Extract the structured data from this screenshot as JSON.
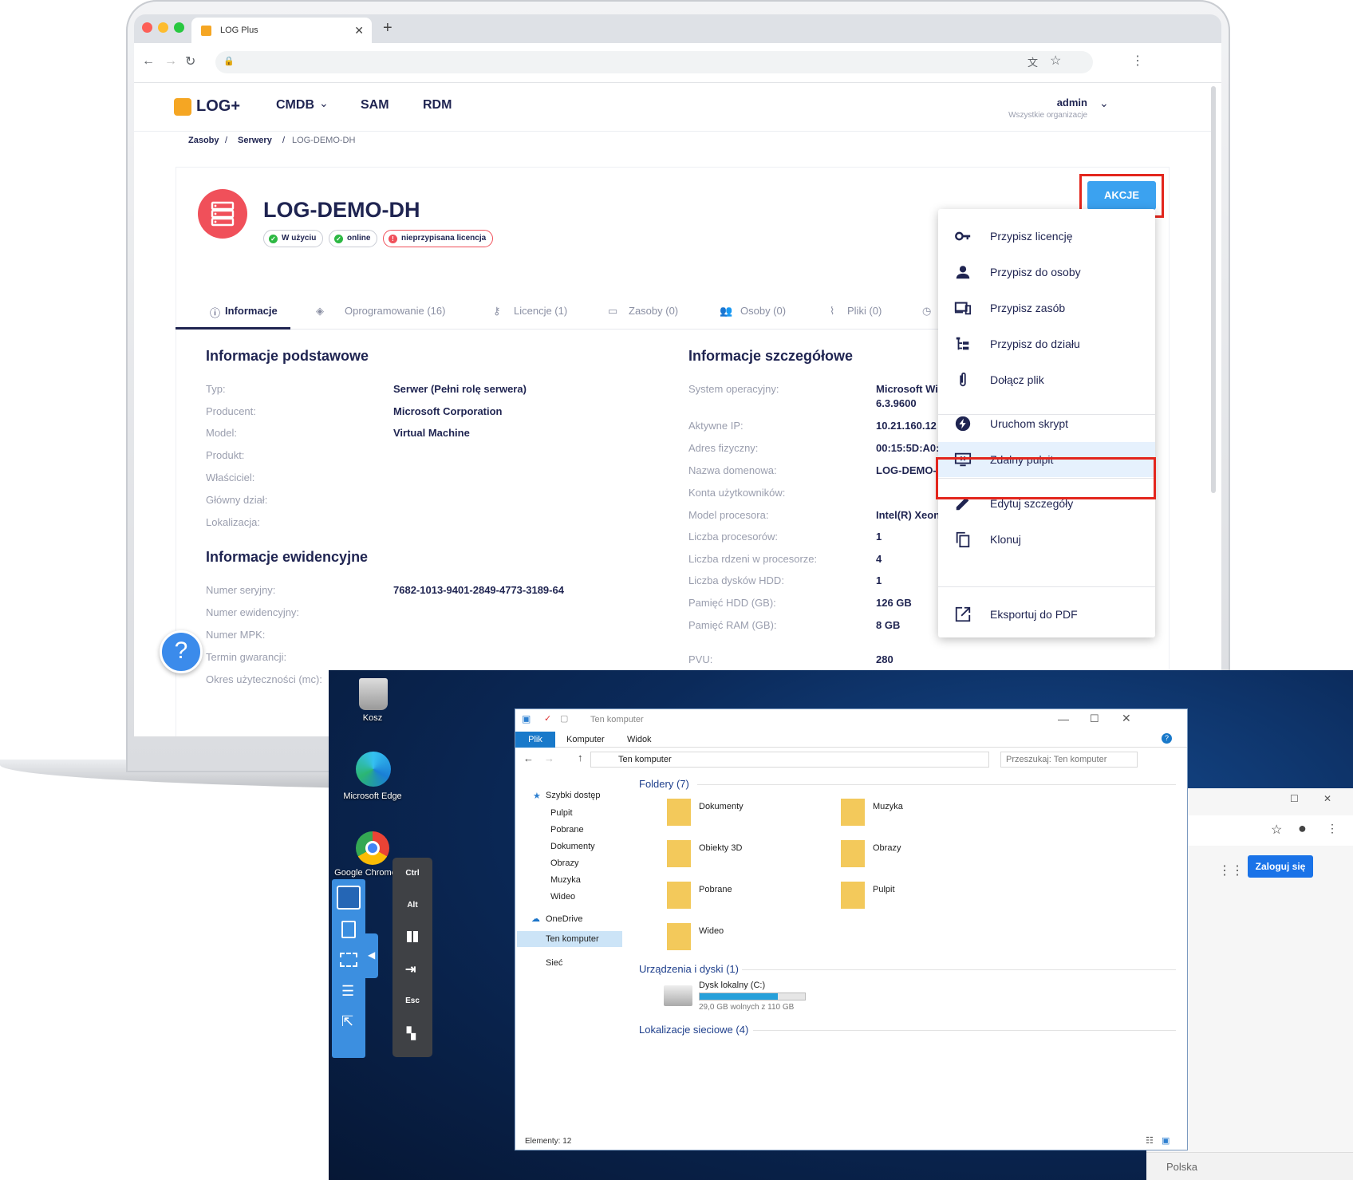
{
  "browser": {
    "tab_title": "LOG Plus",
    "new_tab": "+"
  },
  "app": {
    "logo": "LOG+",
    "nav": [
      "CMDB",
      "SAM",
      "RDM"
    ],
    "user": {
      "name": "admin",
      "org": "Wszystkie organizacje"
    },
    "breadcrumb": [
      "Zasoby",
      "Serwery",
      "LOG-DEMO-DH"
    ],
    "sep": "/"
  },
  "asset": {
    "title": "LOG-DEMO-DH",
    "badges": [
      "W użyciu",
      "online",
      "nieprzypisana licencja"
    ],
    "actions_button": "AKCJE"
  },
  "tabs": [
    "Informacje",
    "Oprogramowanie (16)",
    "Licencje (1)",
    "Zasoby (0)",
    "Osoby (0)",
    "Pliki (0)"
  ],
  "basic": {
    "heading": "Informacje podstawowe",
    "rows": [
      {
        "label": "Typ:",
        "value": "Serwer (Pełni rolę serwera)"
      },
      {
        "label": "Producent:",
        "value": "Microsoft Corporation"
      },
      {
        "label": "Model:",
        "value": "Virtual Machine"
      },
      {
        "label": "Produkt:",
        "value": ""
      },
      {
        "label": "Właściciel:",
        "value": ""
      },
      {
        "label": "Główny dział:",
        "value": ""
      },
      {
        "label": "Lokalizacja:",
        "value": ""
      }
    ]
  },
  "records": {
    "heading": "Informacje ewidencyjne",
    "rows": [
      {
        "label": "Numer seryjny:",
        "value": "7682-1013-9401-2849-4773-3189-64"
      },
      {
        "label": "Numer ewidencyjny:",
        "value": ""
      },
      {
        "label": "Numer MPK:",
        "value": ""
      },
      {
        "label": "Termin gwarancji:",
        "value": ""
      },
      {
        "label": "Okres użyteczności (mc):",
        "value": ""
      }
    ]
  },
  "details": {
    "heading": "Informacje szczegółowe",
    "rows": [
      {
        "label": "System operacyjny:",
        "value": "Microsoft Wi",
        "value2": "6.3.9600"
      },
      {
        "label": "Aktywne IP:",
        "value": "10.21.160.12"
      },
      {
        "label": "Adres fizyczny:",
        "value": "00:15:5D:A0:"
      },
      {
        "label": "Nazwa domenowa:",
        "value": "LOG-DEMO-"
      },
      {
        "label": "Konta użytkowników:",
        "value": ""
      },
      {
        "label": "Model procesora:",
        "value": "Intel(R) Xeon"
      },
      {
        "label": "Liczba procesorów:",
        "value": "1"
      },
      {
        "label": "Liczba rdzeni w procesorze:",
        "value": "4"
      },
      {
        "label": "Liczba dysków HDD:",
        "value": "1"
      },
      {
        "label": "Pamięć HDD (GB):",
        "value": "126 GB"
      },
      {
        "label": "Pamięć RAM (GB):",
        "value": "8 GB"
      },
      {
        "label": "PVU:",
        "value": "280"
      }
    ]
  },
  "menu": [
    {
      "label": "Przypisz licencję",
      "icon": "key-icon"
    },
    {
      "label": "Przypisz do osoby",
      "icon": "person-icon"
    },
    {
      "label": "Przypisz zasób",
      "icon": "devices-icon"
    },
    {
      "label": "Przypisz do działu",
      "icon": "tree-icon"
    },
    {
      "label": "Dołącz plik",
      "icon": "paperclip-icon"
    },
    {
      "label": "Uruchom skrypt",
      "icon": "bolt-icon"
    },
    {
      "label": "Zdalny pulpit",
      "icon": "remote-desktop-icon"
    },
    {
      "label": "Edytuj szczegóły",
      "icon": "pencil-icon"
    },
    {
      "label": "Klonuj",
      "icon": "copy-icon"
    },
    {
      "label": "Eksportuj do PDF",
      "icon": "export-icon"
    }
  ],
  "desktop": {
    "icons": [
      "Kosz",
      "Microsoft Edge",
      "Google Chrome"
    ],
    "keys": [
      "Ctrl",
      "Alt",
      "Esc"
    ],
    "bottom_text": "Polska",
    "login_button": "Zaloguj się"
  },
  "explorer": {
    "title": "Ten komputer",
    "ribbon": [
      "Plik",
      "Komputer",
      "Widok"
    ],
    "path": "Ten komputer",
    "search_placeholder": "Przeszukaj: Ten komputer",
    "nav": {
      "quick": "Szybki dostęp",
      "quick_items": [
        "Pulpit",
        "Pobrane",
        "Dokumenty",
        "Obrazy",
        "Muzyka",
        "Wideo"
      ],
      "onedrive": "OneDrive",
      "this_pc": "Ten komputer",
      "network": "Sieć"
    },
    "folders_header": "Foldery (7)",
    "folders": [
      "Dokumenty",
      "Muzyka",
      "Obiekty 3D",
      "Obrazy",
      "Pobrane",
      "Pulpit",
      "Wideo"
    ],
    "devices_header": "Urządzenia i dyski (1)",
    "drive": {
      "name": "Dysk lokalny (C:)",
      "free": "29,0 GB wolnych z 110 GB",
      "used_fraction": 0.74
    },
    "network_header": "Lokalizacje sieciowe (4)",
    "status": "Elementy: 12"
  },
  "colors": {
    "accent": "#3ba2f0",
    "highlight": "#e3261d",
    "navy": "#1f2451",
    "asset_icon": "#f0505a"
  }
}
